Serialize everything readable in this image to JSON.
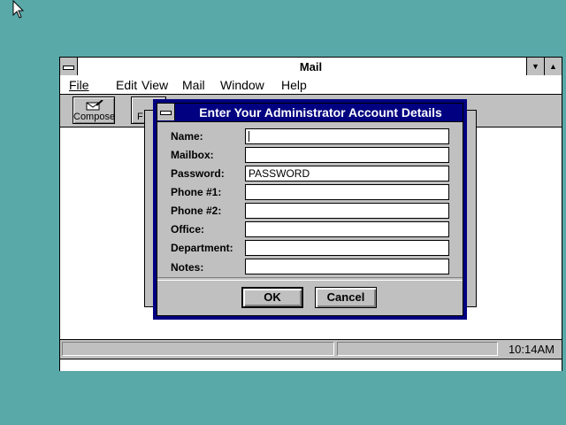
{
  "mail_window": {
    "title": "Mail",
    "menu": [
      "File",
      "Edit",
      "View",
      "Mail",
      "Window",
      "Help"
    ],
    "toolbar": {
      "compose": "Compose",
      "partial": "F"
    },
    "status": {
      "clock": "10:14AM"
    }
  },
  "dialog": {
    "title": "Enter Your Administrator Account Details",
    "fields": [
      {
        "label": "Name:",
        "value": ""
      },
      {
        "label": "Mailbox:",
        "value": ""
      },
      {
        "label": "Password:",
        "value": "PASSWORD"
      },
      {
        "label": "Phone #1:",
        "value": ""
      },
      {
        "label": "Phone #2:",
        "value": ""
      },
      {
        "label": "Office:",
        "value": ""
      },
      {
        "label": "Department:",
        "value": ""
      },
      {
        "label": "Notes:",
        "value": ""
      }
    ],
    "ok": "OK",
    "cancel": "Cancel"
  },
  "colors": {
    "desktop": "#5aa9a9",
    "dialog_title": "#000080",
    "face": "#c0c0c0"
  }
}
